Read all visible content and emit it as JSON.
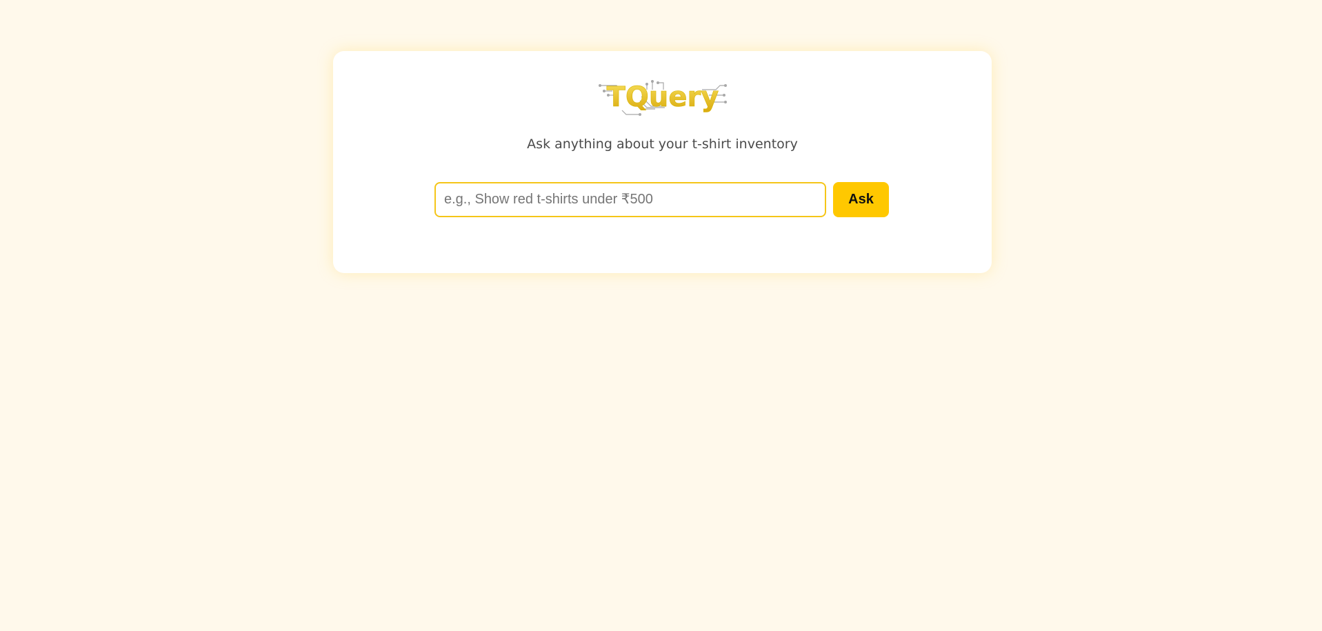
{
  "app": {
    "logo_text": "TQuery",
    "subtitle": "Ask anything about your t-shirt inventory"
  },
  "search": {
    "placeholder": "e.g., Show red t-shirts under ₹500",
    "value": ""
  },
  "actions": {
    "ask_label": "Ask"
  },
  "colors": {
    "background": "#fff9eb",
    "accent": "#ffc800",
    "input_border": "#f5c518",
    "logo_gold": "#e8c21a"
  }
}
